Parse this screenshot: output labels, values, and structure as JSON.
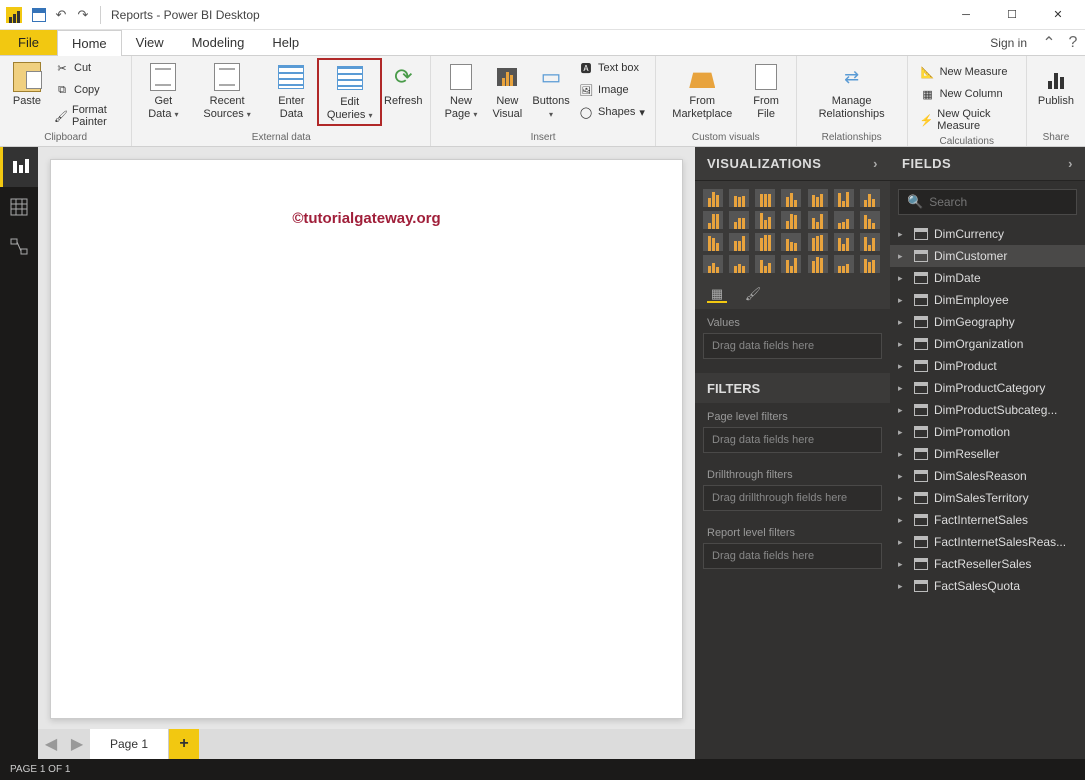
{
  "titlebar": {
    "title": "Reports - Power BI Desktop"
  },
  "menu": {
    "file": "File",
    "tabs": [
      "Home",
      "View",
      "Modeling",
      "Help"
    ],
    "active_tab": "Home",
    "signin": "Sign in"
  },
  "ribbon": {
    "clipboard": {
      "label": "Clipboard",
      "paste": "Paste",
      "cut": "Cut",
      "copy": "Copy",
      "format_painter": "Format Painter"
    },
    "external_data": {
      "label": "External data",
      "get_data": "Get\nData",
      "recent_sources": "Recent\nSources",
      "enter_data": "Enter\nData",
      "edit_queries": "Edit\nQueries",
      "refresh": "Refresh"
    },
    "insert": {
      "label": "Insert",
      "new_page": "New\nPage",
      "new_visual": "New\nVisual",
      "buttons": "Buttons",
      "text_box": "Text box",
      "image": "Image",
      "shapes": "Shapes"
    },
    "custom_visuals": {
      "label": "Custom visuals",
      "marketplace": "From\nMarketplace",
      "from_file": "From\nFile"
    },
    "relationships": {
      "label": "Relationships",
      "manage": "Manage\nRelationships"
    },
    "calculations": {
      "label": "Calculations",
      "new_measure": "New Measure",
      "new_column": "New Column",
      "new_quick_measure": "New Quick Measure"
    },
    "share": {
      "label": "Share",
      "publish": "Publish"
    }
  },
  "canvas": {
    "watermark": "©tutorialgateway.org"
  },
  "page_tabs": {
    "page1": "Page 1"
  },
  "viz_pane": {
    "header": "VISUALIZATIONS",
    "values_label": "Values",
    "drag_here": "Drag data fields here"
  },
  "filters_pane": {
    "header": "FILTERS",
    "page_level": "Page level filters",
    "drag_fields": "Drag data fields here",
    "drillthrough": "Drillthrough filters",
    "drag_drill": "Drag drillthrough fields here",
    "report_level": "Report level filters"
  },
  "fields_pane": {
    "header": "FIELDS",
    "search_placeholder": "Search",
    "tables": [
      "DimCurrency",
      "DimCustomer",
      "DimDate",
      "DimEmployee",
      "DimGeography",
      "DimOrganization",
      "DimProduct",
      "DimProductCategory",
      "DimProductSubcateg...",
      "DimPromotion",
      "DimReseller",
      "DimSalesReason",
      "DimSalesTerritory",
      "FactInternetSales",
      "FactInternetSalesReas...",
      "FactResellerSales",
      "FactSalesQuota"
    ],
    "selected_index": 1
  },
  "status": {
    "text": "PAGE 1 OF 1"
  }
}
